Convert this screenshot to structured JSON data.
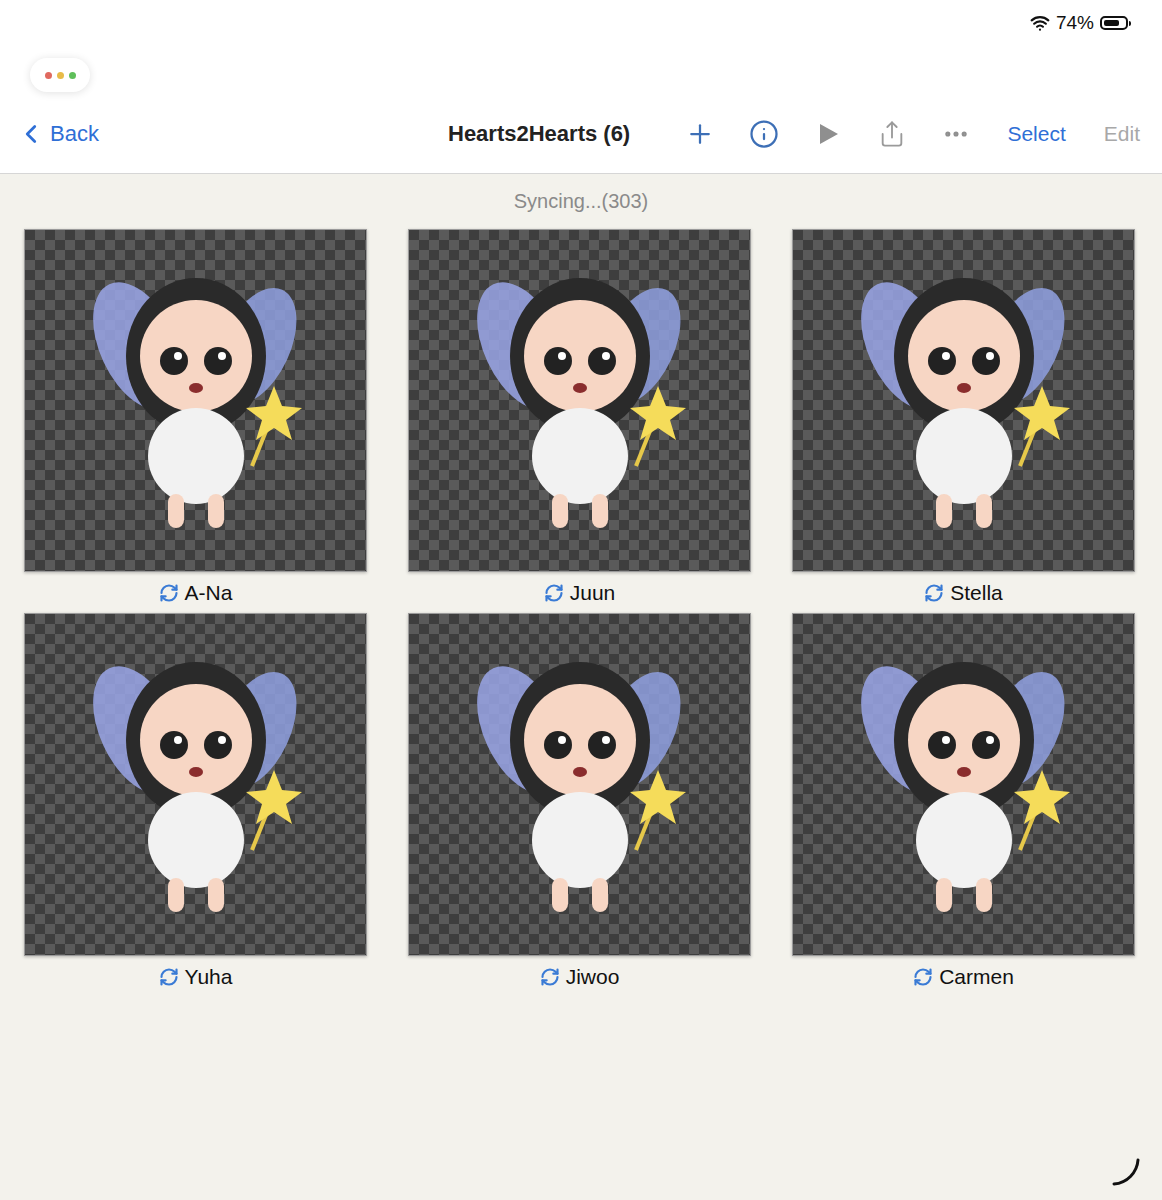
{
  "status_bar": {
    "battery": "74%",
    "battery_level": 0.74
  },
  "toolbar": {
    "back": "Back",
    "title": "Hearts2Hearts (6)",
    "select": "Select",
    "edit": {
      "label": "Edit",
      "disabled": true
    }
  },
  "sync_status": "Syncing...(303)",
  "photos": [
    {
      "name": "A-Na",
      "syncing": true
    },
    {
      "name": "Juun",
      "syncing": true
    },
    {
      "name": "Stella",
      "syncing": true
    },
    {
      "name": "Yuha",
      "syncing": true
    },
    {
      "name": "Jiwoo",
      "syncing": true
    },
    {
      "name": "Carmen",
      "syncing": true
    }
  ]
}
